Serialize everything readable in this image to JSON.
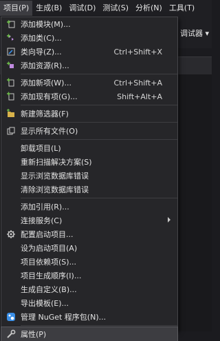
{
  "menubar": {
    "items": [
      "项目(P)",
      "生成(B)",
      "调试(D)",
      "测试(S)",
      "分析(N)",
      "工具(T)"
    ]
  },
  "background": {
    "debugger_label": "调试器 ▾"
  },
  "menu": {
    "groups": [
      [
        {
          "label": "添加模块(M)...",
          "shortcut": "",
          "icon": "add-module-icon"
        },
        {
          "label": "添加类(C)...",
          "shortcut": "",
          "icon": "add-class-icon"
        },
        {
          "label": "类向导(Z)...",
          "shortcut": "Ctrl+Shift+X",
          "icon": "class-wizard-icon"
        },
        {
          "label": "添加资源(R)...",
          "shortcut": "",
          "icon": "add-resource-icon"
        }
      ],
      [
        {
          "label": "添加新项(W)...",
          "shortcut": "Ctrl+Shift+A",
          "icon": "add-new-item-icon"
        },
        {
          "label": "添加现有项(G)...",
          "shortcut": "Shift+Alt+A",
          "icon": "add-existing-item-icon"
        }
      ],
      [
        {
          "label": "新建筛选器(F)",
          "shortcut": "",
          "icon": "new-filter-icon"
        }
      ],
      [
        {
          "label": "显示所有文件(O)",
          "shortcut": "",
          "icon": "show-all-files-icon"
        }
      ],
      [
        {
          "label": "卸载项目(L)",
          "shortcut": "",
          "icon": ""
        },
        {
          "label": "重新扫描解决方案(S)",
          "shortcut": "",
          "icon": ""
        },
        {
          "label": "显示浏览数据库错误",
          "shortcut": "",
          "icon": ""
        },
        {
          "label": "清除浏览数据库错误",
          "shortcut": "",
          "icon": ""
        }
      ],
      [
        {
          "label": "添加引用(R)...",
          "shortcut": "",
          "icon": ""
        },
        {
          "label": "连接服务(C)",
          "shortcut": "",
          "icon": "",
          "submenu": true
        },
        {
          "label": "配置启动项目...",
          "shortcut": "",
          "icon": "gear-icon"
        },
        {
          "label": "设为启动项目(A)",
          "shortcut": "",
          "icon": ""
        },
        {
          "label": "项目依赖项(S)...",
          "shortcut": "",
          "icon": ""
        },
        {
          "label": "项目生成顺序(I)...",
          "shortcut": "",
          "icon": ""
        },
        {
          "label": "生成自定义(B)...",
          "shortcut": "",
          "icon": ""
        },
        {
          "label": "导出模板(E)...",
          "shortcut": "",
          "icon": ""
        },
        {
          "label": "管理 NuGet 程序包(N)...",
          "shortcut": "",
          "icon": "nuget-icon"
        }
      ],
      [
        {
          "label": "属性(P)",
          "shortcut": "",
          "icon": "wrench-icon",
          "highlighted": true
        }
      ]
    ]
  },
  "colors": {
    "accent_blue": "#3a8ee6",
    "plus_green": "#6fbf4a",
    "folder_yellow": "#d8b24a"
  }
}
